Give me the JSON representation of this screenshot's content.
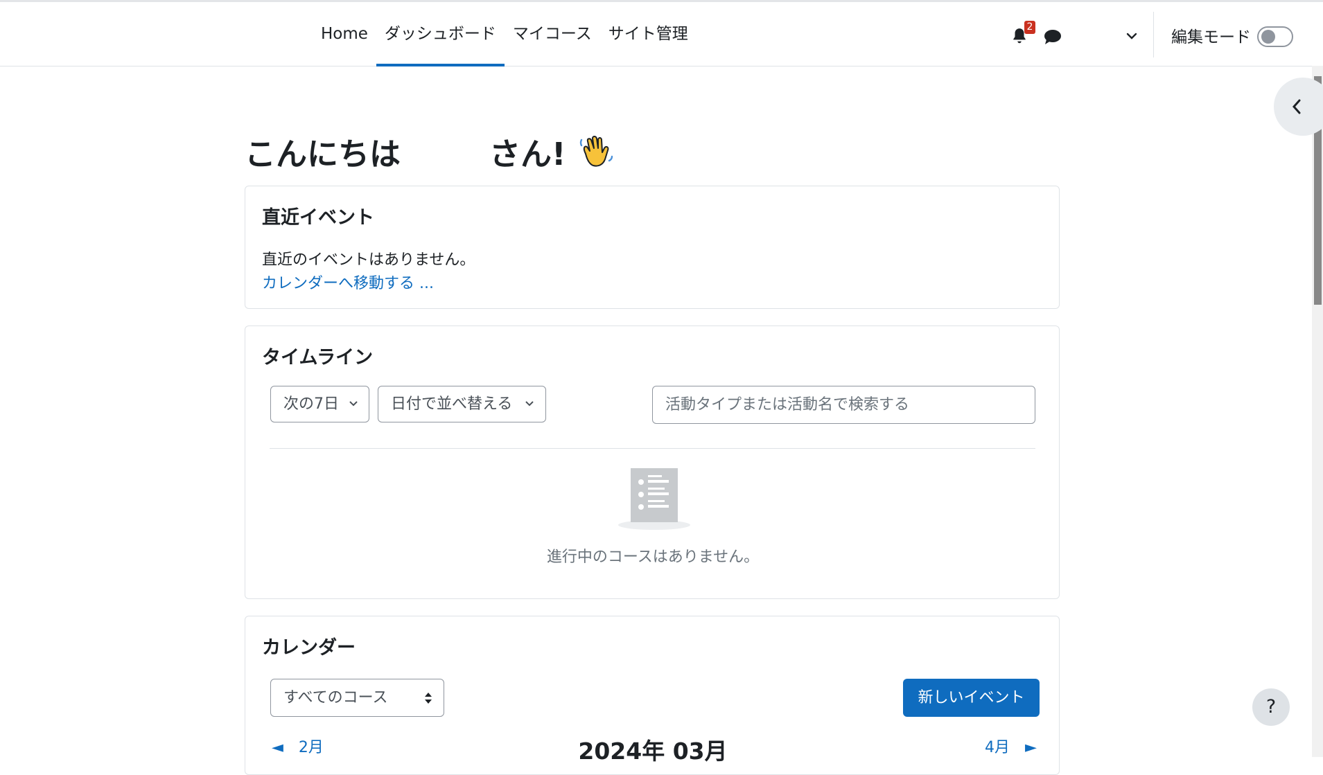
{
  "nav": {
    "items": [
      {
        "label": "Home",
        "active": false
      },
      {
        "label": "ダッシュボード",
        "active": true
      },
      {
        "label": "マイコース",
        "active": false
      },
      {
        "label": "サイト管理",
        "active": false
      }
    ],
    "notification_count": "2",
    "edit_mode_label": "編集モード",
    "edit_mode_on": false,
    "accent_color": "#0f6cbf"
  },
  "greeting": {
    "prefix": "こんにちは",
    "suffix": "さん!",
    "emoji_icon": "waving-hand-icon"
  },
  "upcoming": {
    "title": "直近イベント",
    "empty_text": "直近のイベントはありません。",
    "calendar_link": "カレンダーへ移動する ..."
  },
  "timeline": {
    "title": "タイムライン",
    "filter_label": "次の7日",
    "sort_label": "日付で並べ替える",
    "search_placeholder": "活動タイプまたは活動名で検索する",
    "empty_text": "進行中のコースはありません。"
  },
  "calendar": {
    "title": "カレンダー",
    "course_select": "すべてのコース",
    "new_event_label": "新しいイベント",
    "prev_month": "◄　2月",
    "next_month": "4月　►",
    "current_month": "2024年 03月"
  },
  "help_label": "?"
}
